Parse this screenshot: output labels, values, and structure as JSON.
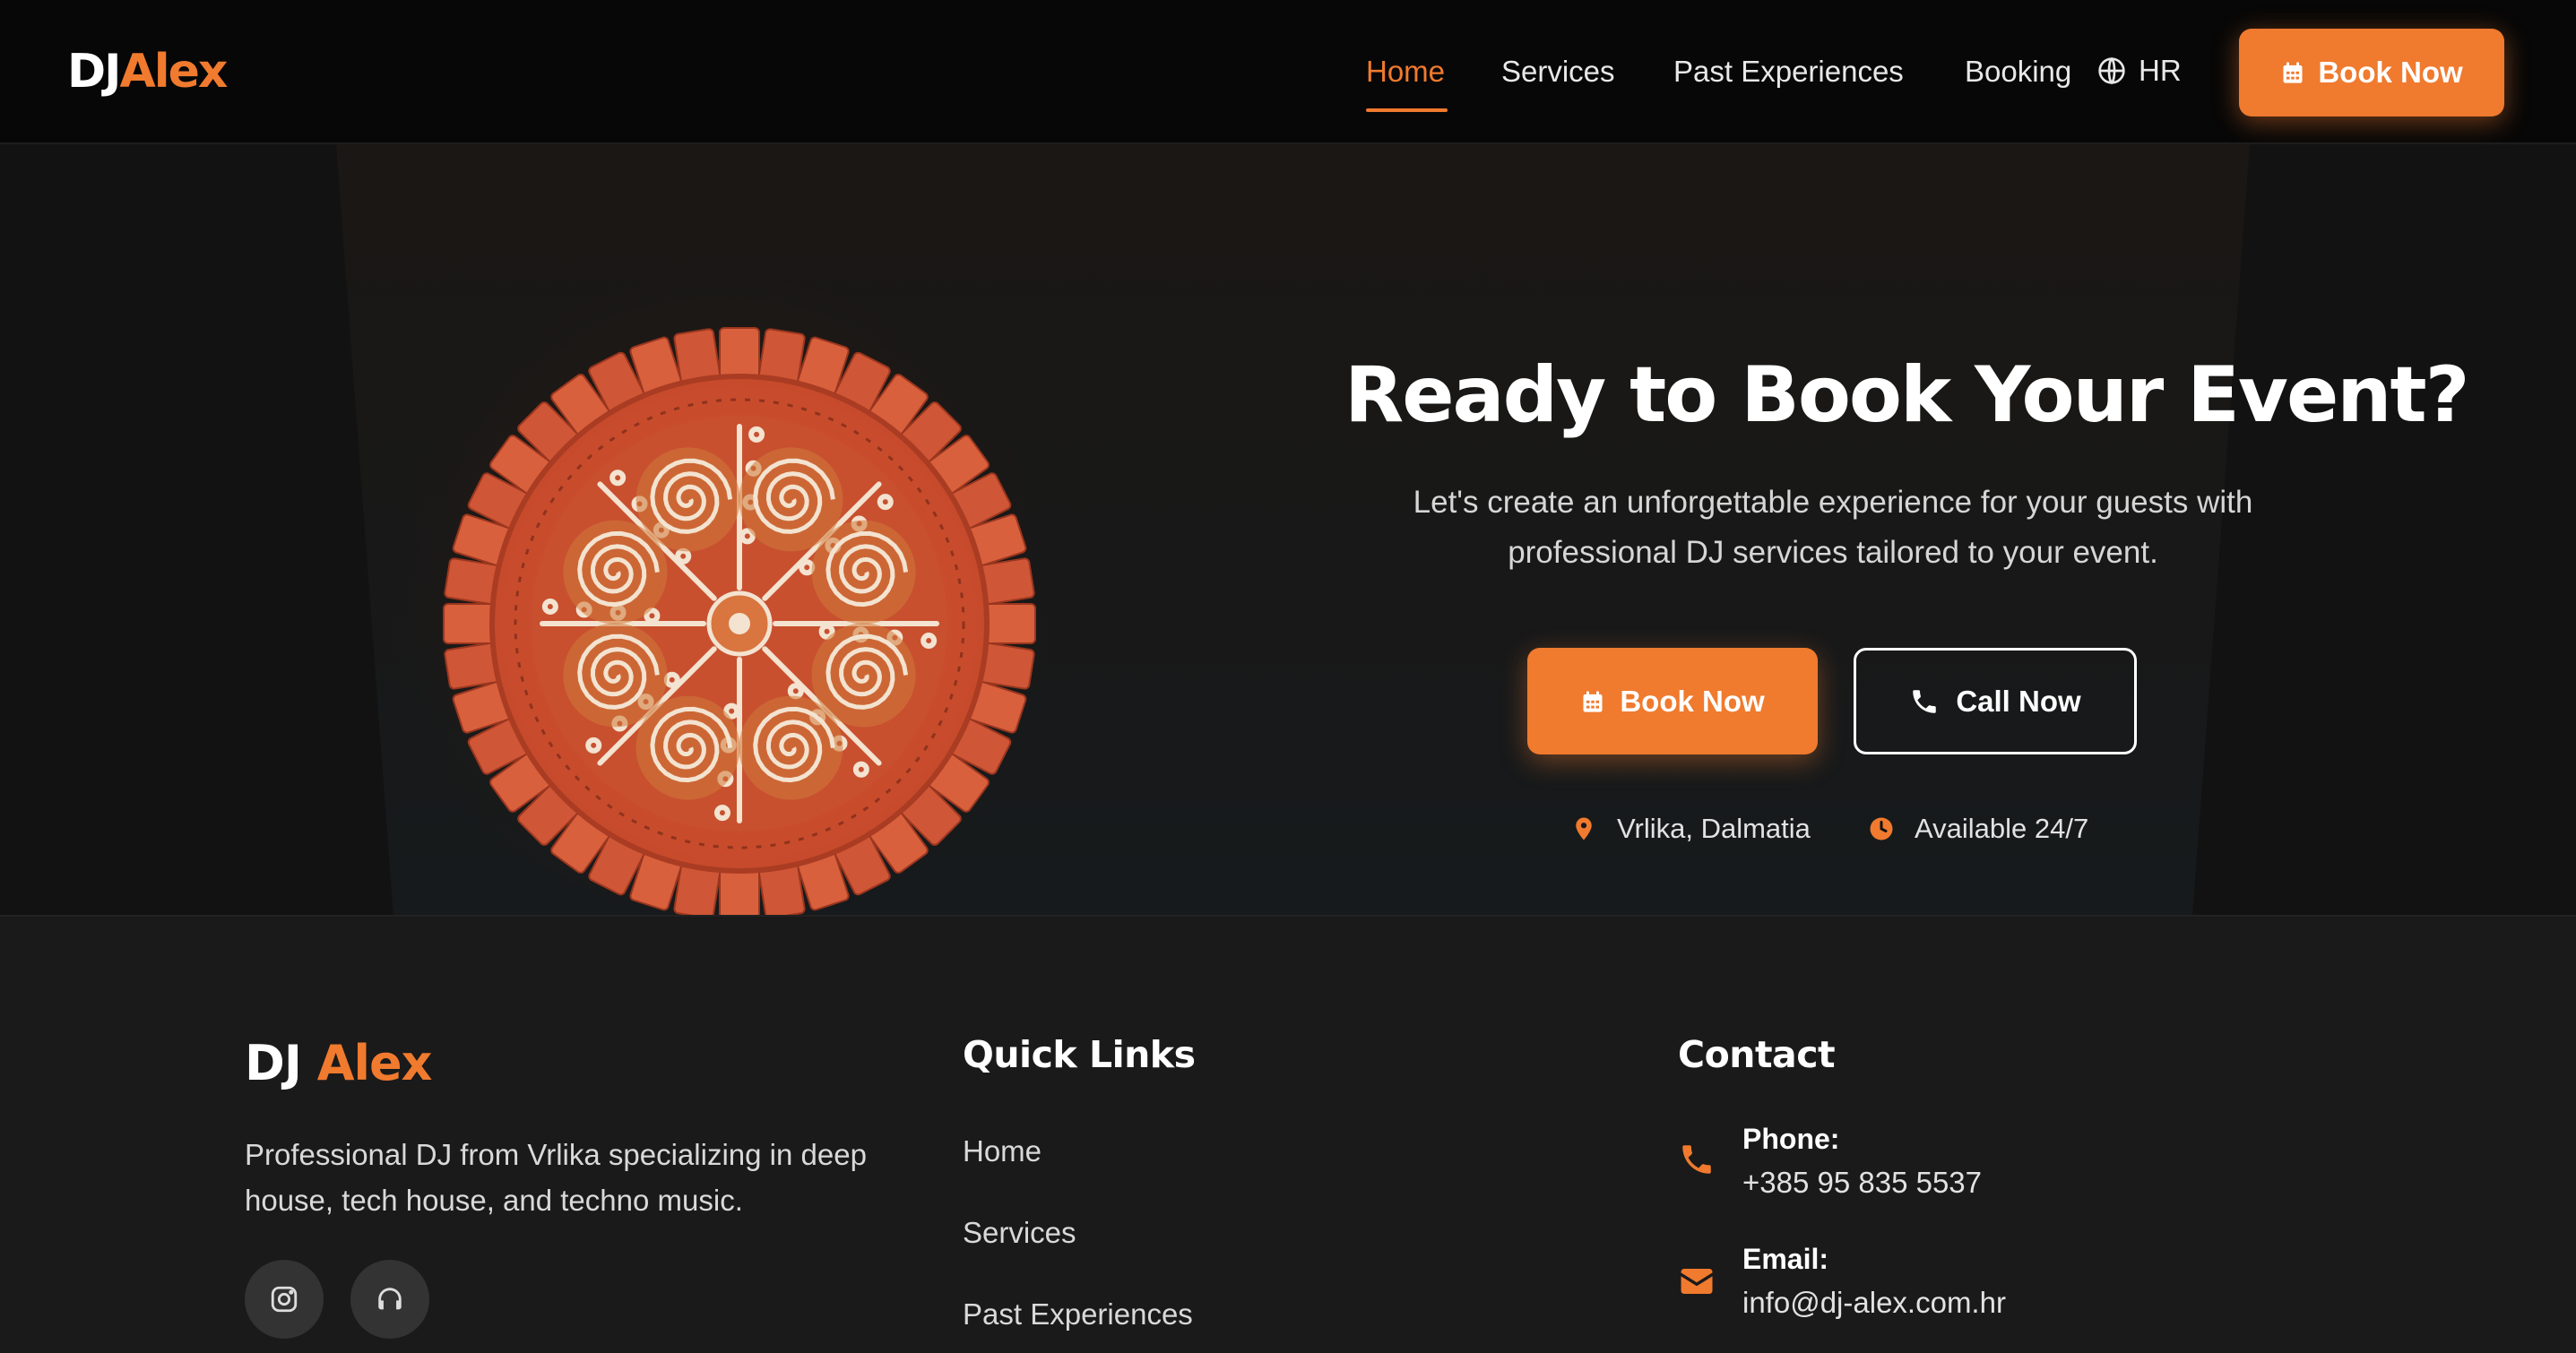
{
  "brand": {
    "first": "DJ",
    "second": "Alex"
  },
  "nav": {
    "links": [
      "Home",
      "Services",
      "Past Experiences",
      "Booking"
    ],
    "active": "Home",
    "language": "HR",
    "book_label": "Book Now"
  },
  "hero": {
    "title": "Ready to Book Your Event?",
    "subtitle": "Let's create an unforgettable experience for your guests with professional DJ services tailored to your event.",
    "book_label": "Book Now",
    "call_label": "Call Now",
    "location": "Vrlika, Dalmatia",
    "availability": "Available 24/7"
  },
  "footer": {
    "brand": {
      "first": "DJ",
      "second": "Alex"
    },
    "description": "Professional DJ from Vrlika specializing in deep house, tech house, and techno music.",
    "social": [
      "instagram-icon",
      "headphones-icon"
    ],
    "quick_links_title": "Quick Links",
    "quick_links": [
      "Home",
      "Services",
      "Past Experiences"
    ],
    "contact_title": "Contact",
    "phone_label": "Phone:",
    "phone": "+385 95 835 5537",
    "email_label": "Email:",
    "email": "info@dj-alex.com.hr"
  },
  "colors": {
    "accent": "#f07a2e",
    "nav_bg": "#070707",
    "footer_bg": "#1a1a1a",
    "hero_bg": "#121212"
  }
}
